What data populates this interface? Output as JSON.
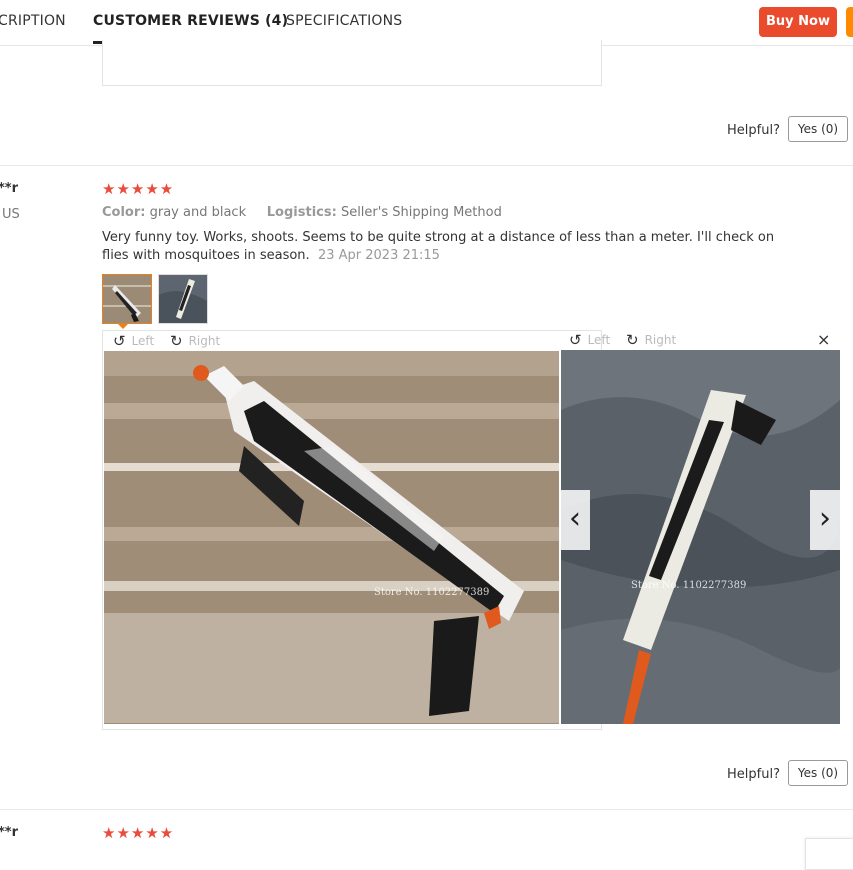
{
  "tabs": {
    "description": "CRIPTION",
    "reviews": "CUSTOMER REVIEWS (4)",
    "specifications": "SPECIFICATIONS"
  },
  "buy_now": "Buy Now",
  "helpful_label": "Helpful?",
  "yes_label": "Yes (0)",
  "review1": {
    "reviewer": "**r",
    "country": "US",
    "stars": "★★★★★",
    "color_label": "Color:",
    "color_value": "gray and black",
    "logistics_label": "Logistics:",
    "logistics_value": "Seller's Shipping Method",
    "text": "Very funny toy. Works, shoots. Seems to be quite strong at a distance of less than a meter. I'll check on flies with mosquitoes in season.",
    "date": "23 Apr 2023 21:15"
  },
  "viewer": {
    "left": "Left",
    "right": "Right",
    "close": "×",
    "prev": "‹",
    "next": "›",
    "watermark": "Store No. 1102277389"
  },
  "review2": {
    "reviewer": "**r",
    "stars": "★★★★★"
  },
  "icons": {
    "rotate_left": "rotate-left-icon",
    "rotate_right": "rotate-right-icon",
    "close": "close-icon",
    "prev": "chevron-left-icon",
    "next": "chevron-right-icon"
  },
  "colors": {
    "buy_now": "#ea4b2c",
    "stars": "#e74c3c",
    "thumb_selected": "#e8811c"
  }
}
